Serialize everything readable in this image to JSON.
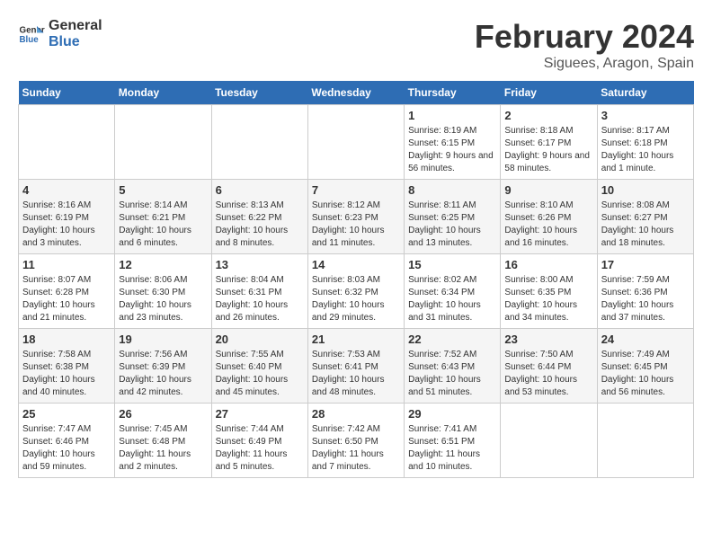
{
  "logo": {
    "line1": "General",
    "line2": "Blue"
  },
  "title": "February 2024",
  "subtitle": "Siguees, Aragon, Spain",
  "days_header": [
    "Sunday",
    "Monday",
    "Tuesday",
    "Wednesday",
    "Thursday",
    "Friday",
    "Saturday"
  ],
  "weeks": [
    [
      {
        "day": "",
        "info": ""
      },
      {
        "day": "",
        "info": ""
      },
      {
        "day": "",
        "info": ""
      },
      {
        "day": "",
        "info": ""
      },
      {
        "day": "1",
        "info": "Sunrise: 8:19 AM\nSunset: 6:15 PM\nDaylight: 9 hours and 56 minutes."
      },
      {
        "day": "2",
        "info": "Sunrise: 8:18 AM\nSunset: 6:17 PM\nDaylight: 9 hours and 58 minutes."
      },
      {
        "day": "3",
        "info": "Sunrise: 8:17 AM\nSunset: 6:18 PM\nDaylight: 10 hours and 1 minute."
      }
    ],
    [
      {
        "day": "4",
        "info": "Sunrise: 8:16 AM\nSunset: 6:19 PM\nDaylight: 10 hours and 3 minutes."
      },
      {
        "day": "5",
        "info": "Sunrise: 8:14 AM\nSunset: 6:21 PM\nDaylight: 10 hours and 6 minutes."
      },
      {
        "day": "6",
        "info": "Sunrise: 8:13 AM\nSunset: 6:22 PM\nDaylight: 10 hours and 8 minutes."
      },
      {
        "day": "7",
        "info": "Sunrise: 8:12 AM\nSunset: 6:23 PM\nDaylight: 10 hours and 11 minutes."
      },
      {
        "day": "8",
        "info": "Sunrise: 8:11 AM\nSunset: 6:25 PM\nDaylight: 10 hours and 13 minutes."
      },
      {
        "day": "9",
        "info": "Sunrise: 8:10 AM\nSunset: 6:26 PM\nDaylight: 10 hours and 16 minutes."
      },
      {
        "day": "10",
        "info": "Sunrise: 8:08 AM\nSunset: 6:27 PM\nDaylight: 10 hours and 18 minutes."
      }
    ],
    [
      {
        "day": "11",
        "info": "Sunrise: 8:07 AM\nSunset: 6:28 PM\nDaylight: 10 hours and 21 minutes."
      },
      {
        "day": "12",
        "info": "Sunrise: 8:06 AM\nSunset: 6:30 PM\nDaylight: 10 hours and 23 minutes."
      },
      {
        "day": "13",
        "info": "Sunrise: 8:04 AM\nSunset: 6:31 PM\nDaylight: 10 hours and 26 minutes."
      },
      {
        "day": "14",
        "info": "Sunrise: 8:03 AM\nSunset: 6:32 PM\nDaylight: 10 hours and 29 minutes."
      },
      {
        "day": "15",
        "info": "Sunrise: 8:02 AM\nSunset: 6:34 PM\nDaylight: 10 hours and 31 minutes."
      },
      {
        "day": "16",
        "info": "Sunrise: 8:00 AM\nSunset: 6:35 PM\nDaylight: 10 hours and 34 minutes."
      },
      {
        "day": "17",
        "info": "Sunrise: 7:59 AM\nSunset: 6:36 PM\nDaylight: 10 hours and 37 minutes."
      }
    ],
    [
      {
        "day": "18",
        "info": "Sunrise: 7:58 AM\nSunset: 6:38 PM\nDaylight: 10 hours and 40 minutes."
      },
      {
        "day": "19",
        "info": "Sunrise: 7:56 AM\nSunset: 6:39 PM\nDaylight: 10 hours and 42 minutes."
      },
      {
        "day": "20",
        "info": "Sunrise: 7:55 AM\nSunset: 6:40 PM\nDaylight: 10 hours and 45 minutes."
      },
      {
        "day": "21",
        "info": "Sunrise: 7:53 AM\nSunset: 6:41 PM\nDaylight: 10 hours and 48 minutes."
      },
      {
        "day": "22",
        "info": "Sunrise: 7:52 AM\nSunset: 6:43 PM\nDaylight: 10 hours and 51 minutes."
      },
      {
        "day": "23",
        "info": "Sunrise: 7:50 AM\nSunset: 6:44 PM\nDaylight: 10 hours and 53 minutes."
      },
      {
        "day": "24",
        "info": "Sunrise: 7:49 AM\nSunset: 6:45 PM\nDaylight: 10 hours and 56 minutes."
      }
    ],
    [
      {
        "day": "25",
        "info": "Sunrise: 7:47 AM\nSunset: 6:46 PM\nDaylight: 10 hours and 59 minutes."
      },
      {
        "day": "26",
        "info": "Sunrise: 7:45 AM\nSunset: 6:48 PM\nDaylight: 11 hours and 2 minutes."
      },
      {
        "day": "27",
        "info": "Sunrise: 7:44 AM\nSunset: 6:49 PM\nDaylight: 11 hours and 5 minutes."
      },
      {
        "day": "28",
        "info": "Sunrise: 7:42 AM\nSunset: 6:50 PM\nDaylight: 11 hours and 7 minutes."
      },
      {
        "day": "29",
        "info": "Sunrise: 7:41 AM\nSunset: 6:51 PM\nDaylight: 11 hours and 10 minutes."
      },
      {
        "day": "",
        "info": ""
      },
      {
        "day": "",
        "info": ""
      }
    ]
  ]
}
